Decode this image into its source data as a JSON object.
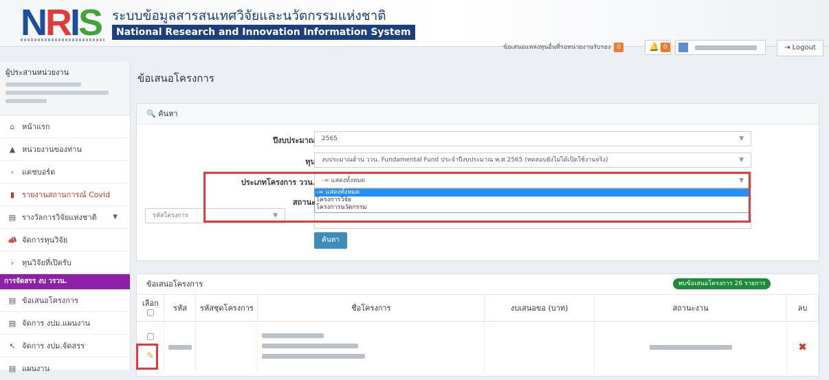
{
  "header": {
    "logo_text": "NRIS",
    "title_th": "ระบบข้อมูลสารสนเทศวิจัยและนวัตกรรมแห่งชาติ",
    "title_en": "National Research and Innovation Information System",
    "pending_proposals_label": "ข้อเสนอแหล่งทุนอื่นที่รอหน่วยงานรับรอง",
    "pending_count": "0",
    "notification_count": "0",
    "logout_label": "Logout"
  },
  "sidebar": {
    "role_label": "ผู้ประสานหน่วยงาน",
    "items": [
      {
        "label": "หน้าแรก",
        "icon": "home-icon"
      },
      {
        "label": "หน่วยงานของท่าน",
        "icon": "bank-icon"
      },
      {
        "label": "แดชบอร์ด",
        "icon": "caret-right-icon"
      },
      {
        "label": "รายงานสถานการณ์ Covid",
        "icon": "book-icon"
      },
      {
        "label": "รางวัลการวิจัยแห่งชาติ",
        "icon": "list-icon"
      },
      {
        "label": "จัดการทุนวิจัย",
        "icon": "bullhorn-icon"
      },
      {
        "label": "ทุนวิจัยที่เปิดรับ",
        "icon": "caret-right-icon"
      },
      {
        "label": "ข้อเสนอโครงการ",
        "icon": "list-icon"
      },
      {
        "label": "จัดการ งปม.แผนงาน",
        "icon": "list-icon"
      },
      {
        "label": "จัดการ งปม.จัดสรร",
        "icon": "pointer-icon"
      },
      {
        "label": "แผนงาน",
        "icon": "list-icon"
      }
    ],
    "section_label": "การจัดสรร งบ วรวน."
  },
  "main": {
    "page_title": "ข้อเสนอโครงการ",
    "search_panel": {
      "title": "ค้นหา",
      "fields": {
        "budget_year_label": "ปีงบประมาณ",
        "budget_year_value": "2565",
        "fund_label": "ทุน",
        "fund_value": "งบประมาณด้าน ววน. Fundamental Fund ประจำปีงบประมาณ พ.ศ.2565 (ทดสอบยังไม่ได้เปิดใช้งานจริง)",
        "project_type_label": "ประเภทโครงการ ววน.",
        "project_type_value": "-= แสดงทั้งหมด",
        "status_label": "สถานะ",
        "project_code_placeholder": "รหัสโครงการ"
      },
      "dropdown_options": [
        "-= แสดงทั้งหมด",
        "โครงการวิจัย",
        "โครงการนวัตกรรม"
      ],
      "search_button": "ค้นหา"
    },
    "results_panel": {
      "title": "ข้อเสนอโครงการ",
      "found_badge": "พบข้อเสนอโครงการ 26 รายการ",
      "columns": [
        "เลือก",
        "รหัส",
        "รหัสชุดโครงการ",
        "ชื่อโครงการ",
        "งบเสนอขอ (บาท)",
        "สถานะงาน",
        "ลบ"
      ]
    }
  },
  "colors": {
    "highlight": "#e33b3b",
    "primary": "#3c8dbc",
    "section": "#8e1fa8"
  }
}
